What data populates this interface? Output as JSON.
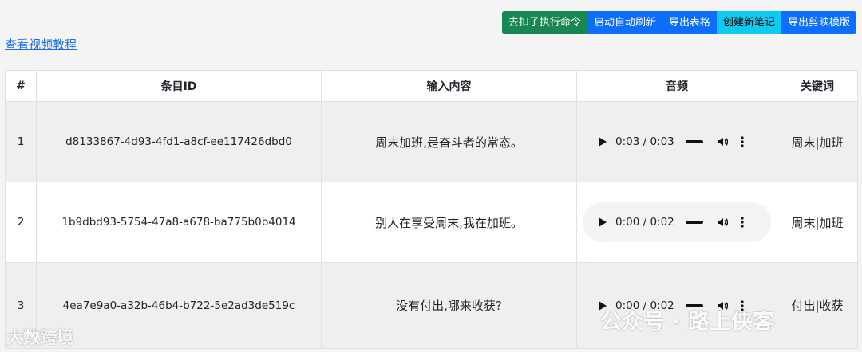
{
  "toolbar": {
    "buttons": [
      {
        "label": "去扣子执行命令",
        "color": "#198754"
      },
      {
        "label": "启动自动刷新",
        "color": "#0d6efd"
      },
      {
        "label": "导出表格",
        "color": "#0d6efd"
      },
      {
        "label": "创建新笔记",
        "color": "#0dcaf0"
      },
      {
        "label": "导出剪映模版",
        "color": "#0d6efd"
      }
    ]
  },
  "tutorial_link": "查看视频教程",
  "table": {
    "headers": [
      "#",
      "条目ID",
      "输入内容",
      "音频",
      "关键词"
    ],
    "rows": [
      {
        "index": "1",
        "id": "d8133867-4d93-4fd1-a8cf-ee117426dbd0",
        "content": "周末加班,是奋斗者的常态。",
        "audio_time": "0:03 / 0:03",
        "keywords": "周末|加班"
      },
      {
        "index": "2",
        "id": "1b9dbd93-5754-47a8-a678-ba775b0b4014",
        "content": "别人在享受周末,我在加班。",
        "audio_time": "0:00 / 0:02",
        "keywords": "周末|加班"
      },
      {
        "index": "3",
        "id": "4ea7e9a0-a32b-46b4-b722-5e2ad3de519c",
        "content": "没有付出,哪来收获?",
        "audio_time": "0:00 / 0:02",
        "keywords": "付出|收获"
      }
    ]
  },
  "watermarks": {
    "left": "大数跨境",
    "right": "公众号 · 路上侠客"
  }
}
